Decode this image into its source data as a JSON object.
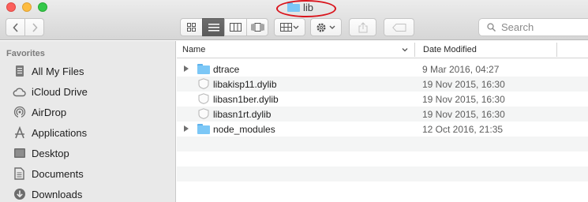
{
  "window": {
    "title": "lib",
    "colors": {
      "close": "#fc605c",
      "minimize": "#fdbc40",
      "maximize": "#34c84a",
      "annotation": "#d9141c"
    }
  },
  "toolbar": {
    "back_icon": "chevron-left-icon",
    "forward_icon": "chevron-right-icon",
    "view_modes": [
      "icon-view-icon",
      "list-view-icon",
      "column-view-icon",
      "cover-flow-icon"
    ],
    "active_view": "list-view-icon",
    "group_icon": "arrange-grid-icon",
    "action_icon": "gear-icon",
    "share_icon": "share-icon",
    "tag_icon": "tag-icon",
    "search_placeholder": "Search"
  },
  "sidebar": {
    "heading": "Favorites",
    "items": [
      {
        "label": "All My Files",
        "icon": "all-files-icon"
      },
      {
        "label": "iCloud Drive",
        "icon": "cloud-icon"
      },
      {
        "label": "AirDrop",
        "icon": "airdrop-icon"
      },
      {
        "label": "Applications",
        "icon": "applications-icon"
      },
      {
        "label": "Desktop",
        "icon": "desktop-icon"
      },
      {
        "label": "Documents",
        "icon": "documents-icon"
      },
      {
        "label": "Downloads",
        "icon": "downloads-icon"
      }
    ]
  },
  "list": {
    "columns": {
      "name": "Name",
      "date": "Date Modified"
    },
    "rows": [
      {
        "name": "dtrace",
        "date": "9 Mar 2016, 04:27",
        "kind": "folder"
      },
      {
        "name": "libakisp11.dylib",
        "date": "19 Nov 2015, 16:30",
        "kind": "file"
      },
      {
        "name": "libasn1ber.dylib",
        "date": "19 Nov 2015, 16:30",
        "kind": "file"
      },
      {
        "name": "libasn1rt.dylib",
        "date": "19 Nov 2015, 16:30",
        "kind": "file"
      },
      {
        "name": "node_modules",
        "date": "12 Oct 2016, 21:35",
        "kind": "folder"
      }
    ]
  }
}
